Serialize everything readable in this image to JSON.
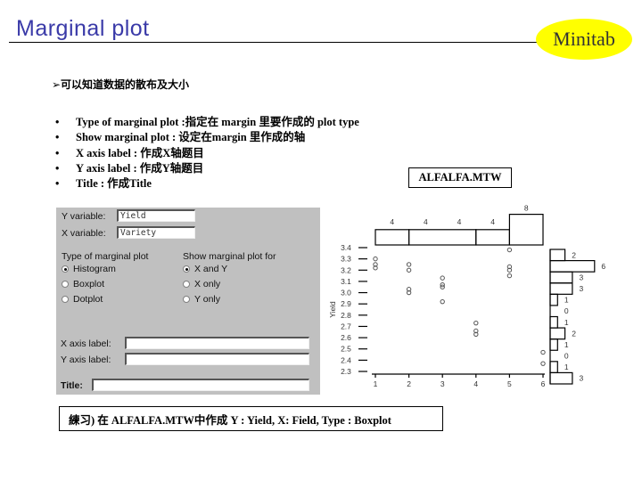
{
  "header": {
    "title": "Marginal plot",
    "logo_text": "Minitab",
    "logo_color": "#ffff00",
    "title_color": "#3a3aa8"
  },
  "subtitle": "➢可以知道数据的散布及大小",
  "bullets": [
    "Type of  marginal plot :指定在 margin 里要作成的 plot type",
    "Show marginal plot : 设定在margin 里作成的轴",
    "X axis label : 作成X轴题目",
    "Y axis label : 作成Y轴题目",
    "Title : 作成Title"
  ],
  "bullet_symbol": "•",
  "file_label": "ALFALFA.MTW",
  "dialog": {
    "y_variable_label": "Y variable:",
    "y_variable_value": "Yield",
    "x_variable_label": "X variable:",
    "x_variable_value": "Variety",
    "type_group_label": "Type of marginal plot",
    "type_options": [
      {
        "label": "Histogram",
        "selected": true
      },
      {
        "label": "Boxplot",
        "selected": false
      },
      {
        "label": "Dotplot",
        "selected": false
      }
    ],
    "show_group_label": "Show marginal plot for",
    "show_options": [
      {
        "label": "X and Y",
        "selected": true
      },
      {
        "label": "X only",
        "selected": false
      },
      {
        "label": "Y only",
        "selected": false
      }
    ],
    "x_axis_label": "X axis label:",
    "x_axis_value": "",
    "y_axis_label": "Y axis label:",
    "y_axis_value": "",
    "title_label": "Title:",
    "title_value": ""
  },
  "chart_data": {
    "type": "scatter",
    "xlabel": "",
    "ylabel": "Yield",
    "xlim": [
      1,
      6
    ],
    "ylim": [
      2.3,
      3.4
    ],
    "x_ticks": [
      "1",
      "2",
      "3",
      "4",
      "5",
      "6"
    ],
    "y_ticks": [
      "3.4",
      "3.3",
      "3.2",
      "3.1",
      "3.0",
      "2.9",
      "2.8",
      "2.7",
      "2.6",
      "2.5",
      "2.4",
      "2.3"
    ],
    "points": [
      {
        "x": 1,
        "y": 3.3
      },
      {
        "x": 1,
        "y": 3.25
      },
      {
        "x": 1,
        "y": 3.22
      },
      {
        "x": 2,
        "y": 3.25
      },
      {
        "x": 2,
        "y": 3.2
      },
      {
        "x": 2,
        "y": 3.03
      },
      {
        "x": 2,
        "y": 3.0
      },
      {
        "x": 3,
        "y": 3.13
      },
      {
        "x": 3,
        "y": 3.07
      },
      {
        "x": 3,
        "y": 3.05
      },
      {
        "x": 3,
        "y": 2.92
      },
      {
        "x": 4,
        "y": 2.73
      },
      {
        "x": 4,
        "y": 2.66
      },
      {
        "x": 4,
        "y": 2.63
      },
      {
        "x": 5,
        "y": 3.38
      },
      {
        "x": 5,
        "y": 3.23
      },
      {
        "x": 5,
        "y": 3.2
      },
      {
        "x": 5,
        "y": 3.15
      },
      {
        "x": 6,
        "y": 2.47
      },
      {
        "x": 6,
        "y": 2.37
      }
    ],
    "top_histogram": {
      "bins": [
        [
          1,
          2
        ],
        [
          2,
          4
        ],
        [
          4,
          5
        ],
        [
          5,
          6
        ]
      ],
      "counts": [
        4,
        4,
        4,
        8
      ],
      "labels": [
        "4",
        "4",
        "4",
        "4",
        "8"
      ]
    },
    "right_histogram": {
      "counts": [
        2,
        6,
        3,
        3,
        1,
        0,
        1,
        2,
        1,
        0,
        1,
        3
      ],
      "labels": [
        "2",
        "6",
        "3",
        "3",
        "1",
        "0",
        "1",
        "2",
        "1",
        "0",
        "1",
        "3"
      ]
    }
  },
  "exercise": "練习) 在 ALFALFA.MTW中作成 Y : Yield, X: Field, Type : Boxplot"
}
